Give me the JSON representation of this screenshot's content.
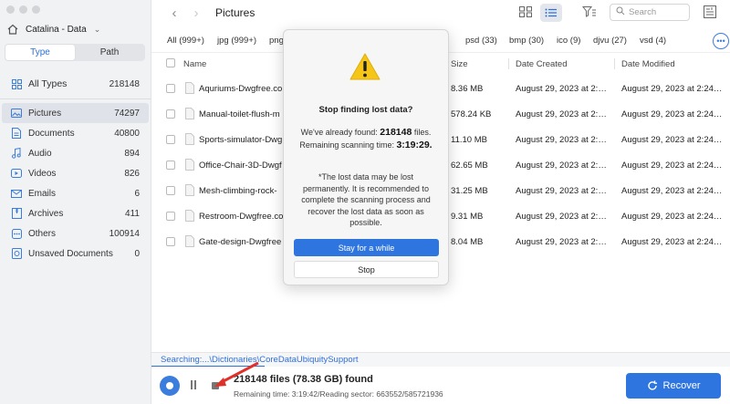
{
  "sidebar": {
    "drive_name": "Catalina - Data",
    "tabs": [
      {
        "label": "Type",
        "active": true
      },
      {
        "label": "Path",
        "active": false
      }
    ],
    "types": [
      {
        "label": "All Types",
        "count": "218148",
        "icon": "grid-icon"
      },
      {
        "label": "Pictures",
        "count": "74297",
        "icon": "image-icon",
        "active": true
      },
      {
        "label": "Documents",
        "count": "40800",
        "icon": "document-icon"
      },
      {
        "label": "Audio",
        "count": "894",
        "icon": "music-icon"
      },
      {
        "label": "Videos",
        "count": "826",
        "icon": "video-icon"
      },
      {
        "label": "Emails",
        "count": "6",
        "icon": "mail-icon"
      },
      {
        "label": "Archives",
        "count": "411",
        "icon": "archive-icon"
      },
      {
        "label": "Others",
        "count": "100914",
        "icon": "others-icon"
      },
      {
        "label": "Unsaved Documents",
        "count": "0",
        "icon": "unsaved-doc-icon"
      }
    ]
  },
  "toolbar": {
    "title": "Pictures",
    "search_placeholder": "Search"
  },
  "filters": [
    "All (999+)",
    "jpg (999+)",
    "png",
    "psd (33)",
    "bmp (30)",
    "ico (9)",
    "djvu (27)",
    "vsd (4)"
  ],
  "table": {
    "headers": {
      "name": "Name",
      "size": "Size",
      "created": "Date Created",
      "modified": "Date Modified"
    },
    "rows": [
      {
        "name": "Aquriums-Dwgfree.co",
        "size": "8.36 MB",
        "created": "August 29, 2023 at 2:…",
        "modified": "August 29, 2023 at 2:24…"
      },
      {
        "name": "Manual-toilet-flush-m",
        "size": "578.24 KB",
        "created": "August 29, 2023 at 2:…",
        "modified": "August 29, 2023 at 2:24…"
      },
      {
        "name": "Sports-simulator-Dwg",
        "size": "11.10 MB",
        "created": "August 29, 2023 at 2:…",
        "modified": "August 29, 2023 at 2:24…"
      },
      {
        "name": "Office-Chair-3D-Dwgf",
        "size": "62.65 MB",
        "created": "August 29, 2023 at 2:…",
        "modified": "August 29, 2023 at 2:24…"
      },
      {
        "name": "Mesh-climbing-rock-",
        "size": "31.25 MB",
        "created": "August 29, 2023 at 2:…",
        "modified": "August 29, 2023 at 2:24…"
      },
      {
        "name": "Restroom-Dwgfree.co",
        "size": "9.31 MB",
        "created": "August 29, 2023 at 2:…",
        "modified": "August 29, 2023 at 2:24…"
      },
      {
        "name": "Gate-design-Dwgfree",
        "size": "8.04 MB",
        "created": "August 29, 2023 at 2:…",
        "modified": "August 29, 2023 at 2:24…"
      }
    ]
  },
  "scan": {
    "searching_path": "Searching:...\\Dictionaries\\CoreDataUbiquitySupport",
    "found": "218148 files (78.38 GB) found",
    "remaining": "Remaining time: 3:19:42/Reading sector: 663552/585721936",
    "recover_label": "Recover"
  },
  "dialog": {
    "title": "Stop finding lost data?",
    "found_prefix": "We've already found: ",
    "found_value": "218148",
    "found_suffix": " files.",
    "remaining_prefix": "Remaining scanning time: ",
    "remaining_value": "3:19:29.",
    "note": "*The lost data may be lost permanently. It is recommended to complete the scanning process and recover the lost data as soon as possible.",
    "stay_label": "Stay for a while",
    "stop_label": "Stop"
  },
  "colors": {
    "accent": "#2f75e0",
    "warning": "#f5c518",
    "annotation_arrow": "#e0302a"
  }
}
